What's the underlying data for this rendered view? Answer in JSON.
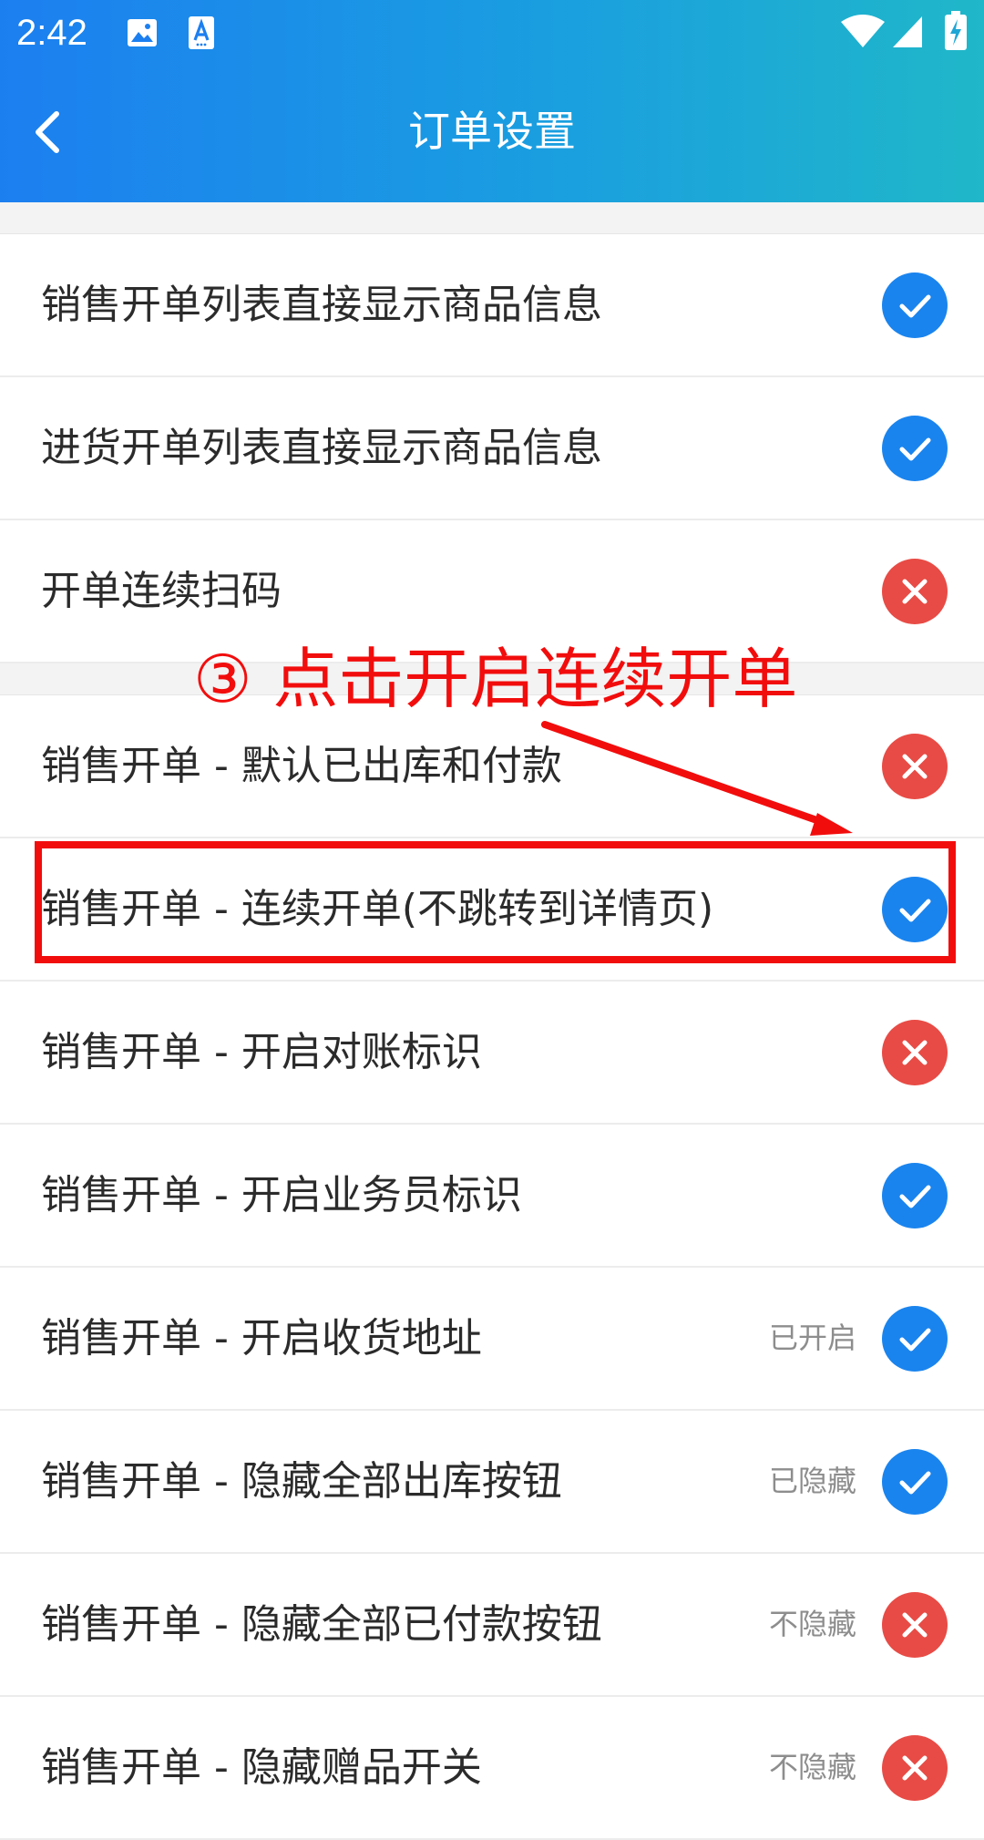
{
  "status_bar": {
    "time": "2:42",
    "icons": [
      "image-icon",
      "a-notification-icon",
      "wifi-icon",
      "signal-icon",
      "battery-icon"
    ]
  },
  "toolbar": {
    "title": "订单设置",
    "back_icon": "chevron-left-icon"
  },
  "settings": [
    {
      "label": "销售开单列表直接显示商品信息",
      "status": "",
      "enabled": true
    },
    {
      "label": "进货开单列表直接显示商品信息",
      "status": "",
      "enabled": true
    },
    {
      "label": "开单连续扫码",
      "status": "",
      "enabled": false
    },
    {
      "label": "销售开单 - 默认已出库和付款",
      "status": "",
      "enabled": false
    },
    {
      "label": "销售开单 - 连续开单(不跳转到详情页)",
      "status": "",
      "enabled": true
    },
    {
      "label": "销售开单 - 开启对账标识",
      "status": "",
      "enabled": false
    },
    {
      "label": "销售开单 - 开启业务员标识",
      "status": "",
      "enabled": true
    },
    {
      "label": "销售开单 - 开启收货地址",
      "status": "已开启",
      "enabled": true
    },
    {
      "label": "销售开单 - 隐藏全部出库按钮",
      "status": "已隐藏",
      "enabled": true
    },
    {
      "label": "销售开单 - 隐藏全部已付款按钮",
      "status": "不隐藏",
      "enabled": false
    },
    {
      "label": "销售开单 - 隐藏赠品开关",
      "status": "不隐藏",
      "enabled": false
    }
  ],
  "annotation": {
    "text": "③ 点击开启连续开单",
    "color": "#f20d0d"
  },
  "colors": {
    "on": "#1a84ee",
    "off": "#e84b45"
  }
}
